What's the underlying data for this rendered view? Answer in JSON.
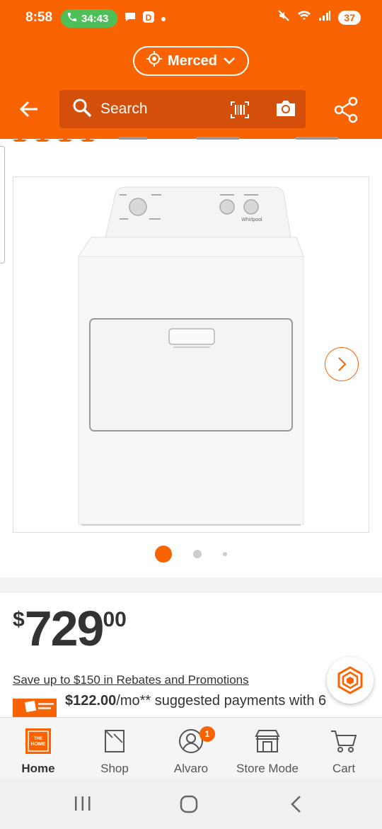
{
  "status_bar": {
    "time": "8:58",
    "call_timer": "34:43",
    "battery": "37"
  },
  "header": {
    "store_name": "Merced",
    "search_placeholder": "Search"
  },
  "gallery": {
    "image_alt": "Whirlpool dryer",
    "brand_on_image": "Whirlpool",
    "dot_count": 3,
    "active_dot": 0
  },
  "price": {
    "currency": "$",
    "dollars": "729",
    "cents": "00"
  },
  "promo": {
    "rebate_link": "Save up to $150 in Rebates and Promotions",
    "financing_amount": "$122.00",
    "financing_rest": "/mo** suggested payments with 6"
  },
  "bottom_nav": {
    "items": [
      {
        "label": "Home",
        "icon": "home-depot-logo-icon"
      },
      {
        "label": "Shop",
        "icon": "shop-icon"
      },
      {
        "label": "Alvaro",
        "icon": "account-icon",
        "badge": "1"
      },
      {
        "label": "Store Mode",
        "icon": "store-icon"
      },
      {
        "label": "Cart",
        "icon": "cart-icon"
      }
    ]
  },
  "colors": {
    "brand_orange": "#f96302",
    "call_green": "#4fbf5a"
  }
}
